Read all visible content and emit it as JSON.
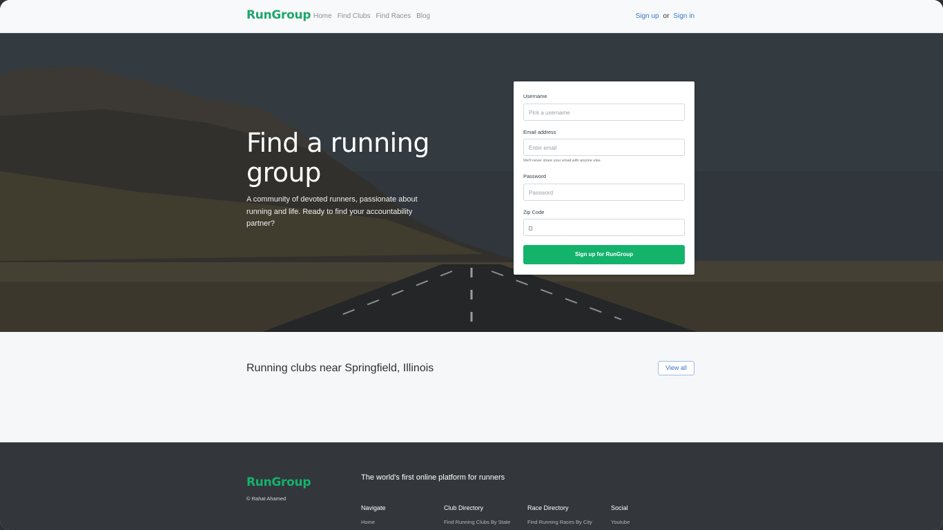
{
  "nav": {
    "brand": "RunGroup",
    "links": [
      "Home",
      "Find Clubs",
      "Find Races",
      "Blog"
    ],
    "signup": "Sign up",
    "or": "or",
    "signin": "Sign in"
  },
  "hero": {
    "title": "Find a running group",
    "subtitle": "A community of devoted runners, passionate about running and life. Ready to find your accountability partner?"
  },
  "form": {
    "username_label": "Username",
    "username_placeholder": "Pick a username",
    "email_label": "Email address",
    "email_placeholder": "Enter email",
    "email_help": "We'll never share your email with anyone else.",
    "password_label": "Password",
    "password_placeholder": "Password",
    "zip_label": "Zip Code",
    "submit": "Sign up for RunGroup"
  },
  "clubs": {
    "heading": "Running clubs near Springfield, Illinois",
    "view_all": "View all"
  },
  "footer": {
    "brand": "RunGroup",
    "copyright": "© Rahat Ahamed",
    "tagline": "The world's first online platform for runners",
    "columns": [
      {
        "title": "Navigate",
        "items": [
          "Home"
        ]
      },
      {
        "title": "Club Directory",
        "items": [
          "Find Running Clubs By State"
        ]
      },
      {
        "title": "Race Directory",
        "items": [
          "Find Running Races By City"
        ]
      },
      {
        "title": "Social",
        "items": [
          "Youtube"
        ]
      }
    ]
  },
  "colors": {
    "brand_green": "#13b36c",
    "link_blue": "#3b74c9",
    "footer_bg": "#33373b"
  }
}
